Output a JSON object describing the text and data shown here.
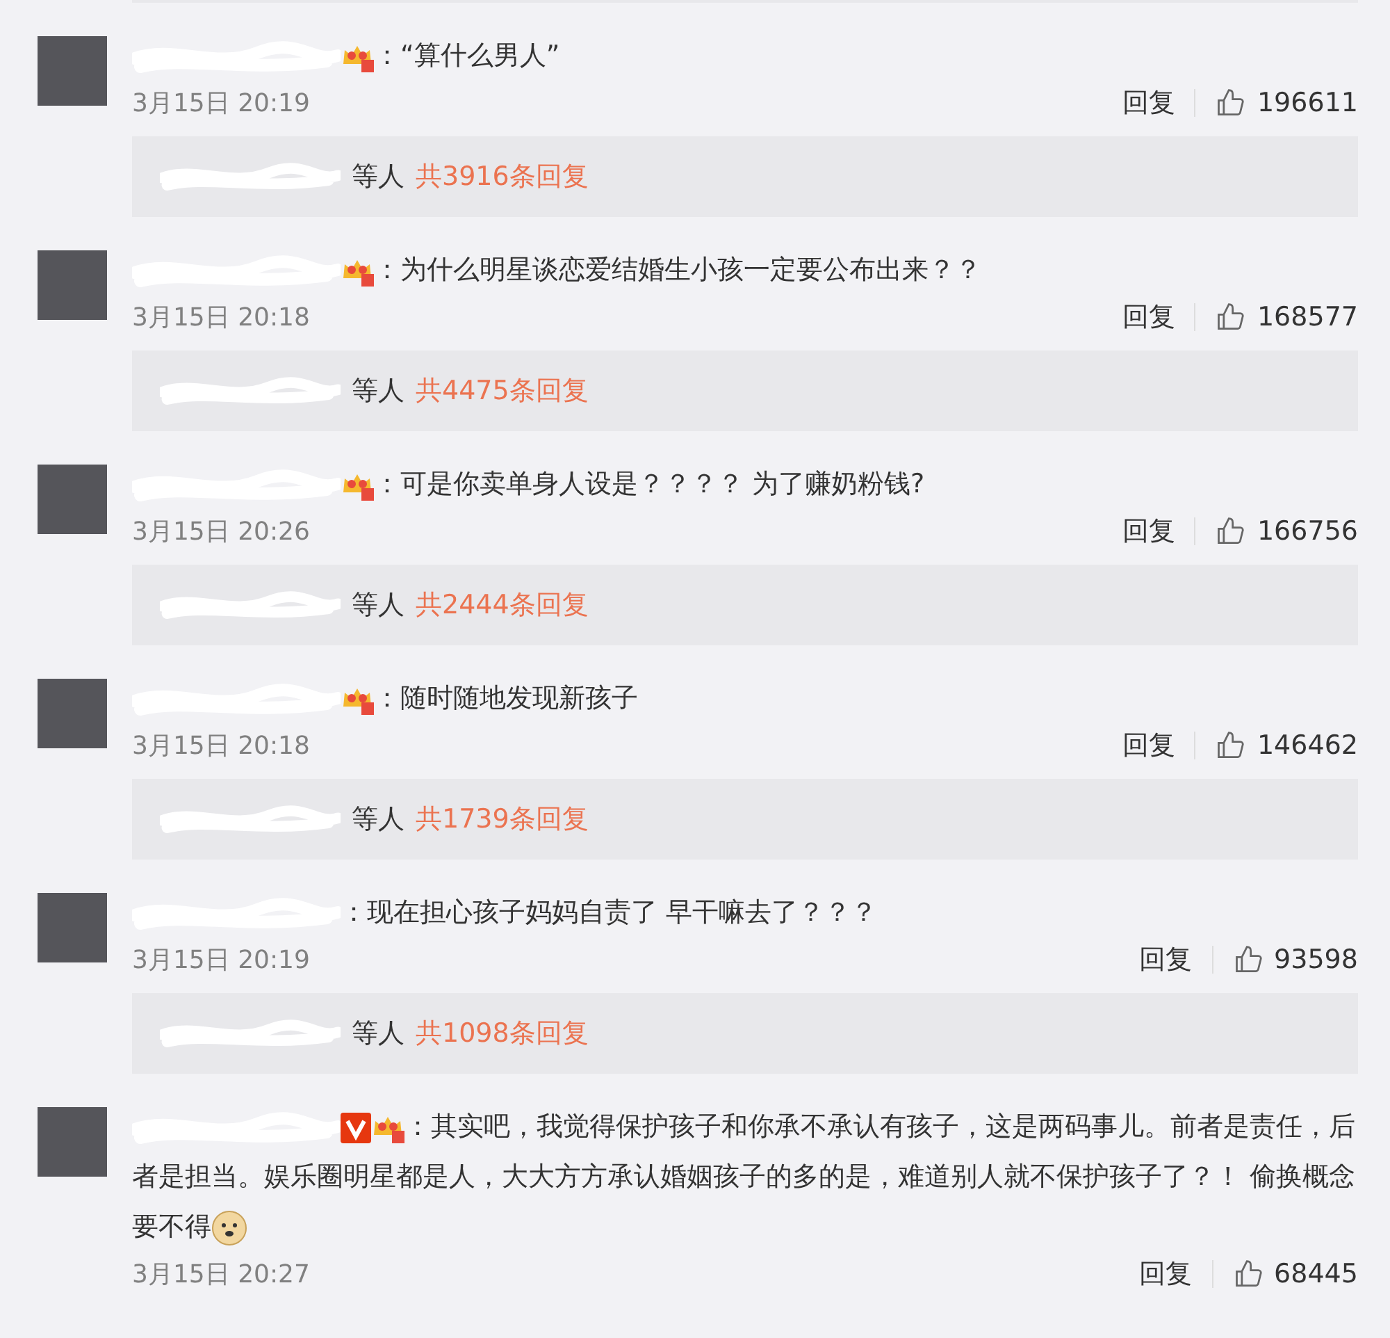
{
  "comments": [
    {
      "crown": true,
      "text": "：“算什么男人”",
      "time": "3月15日 20:19",
      "reply_action": "回复",
      "likes": "196611",
      "thread": {
        "others": "等人",
        "count": "共3916条回复"
      }
    },
    {
      "crown": true,
      "text": "：为什么明星谈恋爱结婚生小孩一定要公布出来？？",
      "time": "3月15日 20:18",
      "reply_action": "回复",
      "likes": "168577",
      "thread": {
        "others": "等人",
        "count": "共4475条回复"
      }
    },
    {
      "crown": true,
      "text": "：可是你卖单身人设是？？？？ 为了赚奶粉钱?",
      "time": "3月15日 20:26",
      "reply_action": "回复",
      "likes": "166756",
      "thread": {
        "others": "等人",
        "count": "共2444条回复"
      }
    },
    {
      "crown": true,
      "text": "：随时随地发现新孩子",
      "time": "3月15日 20:18",
      "reply_action": "回复",
      "likes": "146462",
      "thread": {
        "others": "等人",
        "count": "共1739条回复"
      }
    },
    {
      "text": "：现在担心孩子妈妈自责了  早干嘛去了？？？",
      "time": "3月15日 20:19",
      "reply_action": "回复",
      "likes": "93598",
      "thread": {
        "others": "等人",
        "count": "共1098条回复"
      }
    },
    {
      "verified": true,
      "crown": true,
      "text": "：其实吧，我觉得保护孩子和你承不承认有孩子，这是两码事儿。前者是责任，后者是担当。娱乐圈明星都是人，大大方方承认婚姻孩子的多的是，难道别人就不保护孩子了？！ 偷换概念要不得",
      "emoji": true,
      "time": "3月15日 20:27",
      "reply_action": "回复",
      "likes": "68445"
    }
  ]
}
